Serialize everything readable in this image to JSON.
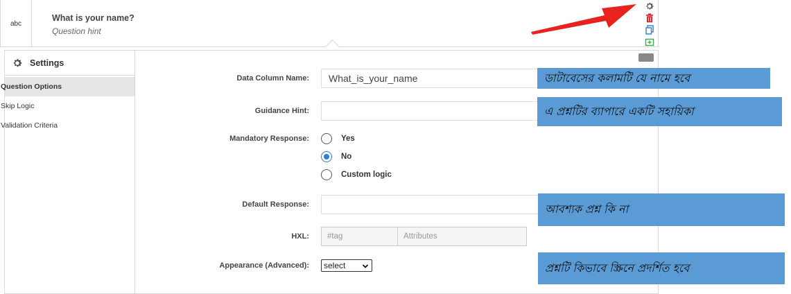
{
  "question": {
    "type_label": "abc",
    "label": "What is your name?",
    "hint": "Question hint"
  },
  "sidebar": {
    "title": "Settings",
    "items": [
      {
        "label": "Question Options",
        "active": true
      },
      {
        "label": "Skip Logic",
        "active": false
      },
      {
        "label": "Validation Criteria",
        "active": false
      }
    ]
  },
  "form": {
    "data_column_label": "Data Column Name:",
    "data_column_value": "What_is_your_name",
    "guidance_label": "Guidance Hint:",
    "guidance_value": "",
    "mandatory_label": "Mandatory Response:",
    "mandatory_options": [
      {
        "label": "Yes",
        "checked": false
      },
      {
        "label": "No",
        "checked": true
      },
      {
        "label": "Custom logic",
        "checked": false
      }
    ],
    "default_label": "Default Response:",
    "default_value": "",
    "hxl_label": "HXL:",
    "hxl_tag_placeholder": "#tag",
    "hxl_attr_placeholder": "Attributes",
    "appearance_label": "Appearance (Advanced):",
    "appearance_value": "select"
  },
  "callouts": {
    "data_column": "ডাটাবেসের কলামটি যে নামে হবে",
    "guidance": "এ প্রশ্নটির ব্যাপারে একটি সহায়িকা",
    "mandatory": "আবশ্যক প্রশ্ন কি না",
    "appearance": "প্রশ্নটি কিভাবে স্ক্রিনে প্রদর্শিত হবে"
  },
  "colors": {
    "callout_bg": "#5b9bd5",
    "arrow": "#e8231f",
    "radio_checked": "#2b7fd6",
    "delete_icon": "#e0282e",
    "copy_icon": "#2e7bd0",
    "add_icon": "#3aa84a"
  }
}
